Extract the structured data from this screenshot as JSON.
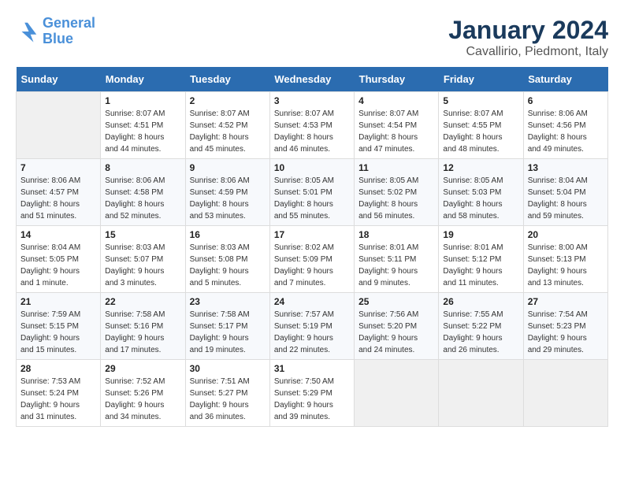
{
  "header": {
    "logo_line1": "General",
    "logo_line2": "Blue",
    "title": "January 2024",
    "subtitle": "Cavallirio, Piedmont, Italy"
  },
  "weekdays": [
    "Sunday",
    "Monday",
    "Tuesday",
    "Wednesday",
    "Thursday",
    "Friday",
    "Saturday"
  ],
  "weeks": [
    [
      {
        "day": "",
        "info": ""
      },
      {
        "day": "1",
        "info": "Sunrise: 8:07 AM\nSunset: 4:51 PM\nDaylight: 8 hours\nand 44 minutes."
      },
      {
        "day": "2",
        "info": "Sunrise: 8:07 AM\nSunset: 4:52 PM\nDaylight: 8 hours\nand 45 minutes."
      },
      {
        "day": "3",
        "info": "Sunrise: 8:07 AM\nSunset: 4:53 PM\nDaylight: 8 hours\nand 46 minutes."
      },
      {
        "day": "4",
        "info": "Sunrise: 8:07 AM\nSunset: 4:54 PM\nDaylight: 8 hours\nand 47 minutes."
      },
      {
        "day": "5",
        "info": "Sunrise: 8:07 AM\nSunset: 4:55 PM\nDaylight: 8 hours\nand 48 minutes."
      },
      {
        "day": "6",
        "info": "Sunrise: 8:06 AM\nSunset: 4:56 PM\nDaylight: 8 hours\nand 49 minutes."
      }
    ],
    [
      {
        "day": "7",
        "info": "Sunrise: 8:06 AM\nSunset: 4:57 PM\nDaylight: 8 hours\nand 51 minutes."
      },
      {
        "day": "8",
        "info": "Sunrise: 8:06 AM\nSunset: 4:58 PM\nDaylight: 8 hours\nand 52 minutes."
      },
      {
        "day": "9",
        "info": "Sunrise: 8:06 AM\nSunset: 4:59 PM\nDaylight: 8 hours\nand 53 minutes."
      },
      {
        "day": "10",
        "info": "Sunrise: 8:05 AM\nSunset: 5:01 PM\nDaylight: 8 hours\nand 55 minutes."
      },
      {
        "day": "11",
        "info": "Sunrise: 8:05 AM\nSunset: 5:02 PM\nDaylight: 8 hours\nand 56 minutes."
      },
      {
        "day": "12",
        "info": "Sunrise: 8:05 AM\nSunset: 5:03 PM\nDaylight: 8 hours\nand 58 minutes."
      },
      {
        "day": "13",
        "info": "Sunrise: 8:04 AM\nSunset: 5:04 PM\nDaylight: 8 hours\nand 59 minutes."
      }
    ],
    [
      {
        "day": "14",
        "info": "Sunrise: 8:04 AM\nSunset: 5:05 PM\nDaylight: 9 hours\nand 1 minute."
      },
      {
        "day": "15",
        "info": "Sunrise: 8:03 AM\nSunset: 5:07 PM\nDaylight: 9 hours\nand 3 minutes."
      },
      {
        "day": "16",
        "info": "Sunrise: 8:03 AM\nSunset: 5:08 PM\nDaylight: 9 hours\nand 5 minutes."
      },
      {
        "day": "17",
        "info": "Sunrise: 8:02 AM\nSunset: 5:09 PM\nDaylight: 9 hours\nand 7 minutes."
      },
      {
        "day": "18",
        "info": "Sunrise: 8:01 AM\nSunset: 5:11 PM\nDaylight: 9 hours\nand 9 minutes."
      },
      {
        "day": "19",
        "info": "Sunrise: 8:01 AM\nSunset: 5:12 PM\nDaylight: 9 hours\nand 11 minutes."
      },
      {
        "day": "20",
        "info": "Sunrise: 8:00 AM\nSunset: 5:13 PM\nDaylight: 9 hours\nand 13 minutes."
      }
    ],
    [
      {
        "day": "21",
        "info": "Sunrise: 7:59 AM\nSunset: 5:15 PM\nDaylight: 9 hours\nand 15 minutes."
      },
      {
        "day": "22",
        "info": "Sunrise: 7:58 AM\nSunset: 5:16 PM\nDaylight: 9 hours\nand 17 minutes."
      },
      {
        "day": "23",
        "info": "Sunrise: 7:58 AM\nSunset: 5:17 PM\nDaylight: 9 hours\nand 19 minutes."
      },
      {
        "day": "24",
        "info": "Sunrise: 7:57 AM\nSunset: 5:19 PM\nDaylight: 9 hours\nand 22 minutes."
      },
      {
        "day": "25",
        "info": "Sunrise: 7:56 AM\nSunset: 5:20 PM\nDaylight: 9 hours\nand 24 minutes."
      },
      {
        "day": "26",
        "info": "Sunrise: 7:55 AM\nSunset: 5:22 PM\nDaylight: 9 hours\nand 26 minutes."
      },
      {
        "day": "27",
        "info": "Sunrise: 7:54 AM\nSunset: 5:23 PM\nDaylight: 9 hours\nand 29 minutes."
      }
    ],
    [
      {
        "day": "28",
        "info": "Sunrise: 7:53 AM\nSunset: 5:24 PM\nDaylight: 9 hours\nand 31 minutes."
      },
      {
        "day": "29",
        "info": "Sunrise: 7:52 AM\nSunset: 5:26 PM\nDaylight: 9 hours\nand 34 minutes."
      },
      {
        "day": "30",
        "info": "Sunrise: 7:51 AM\nSunset: 5:27 PM\nDaylight: 9 hours\nand 36 minutes."
      },
      {
        "day": "31",
        "info": "Sunrise: 7:50 AM\nSunset: 5:29 PM\nDaylight: 9 hours\nand 39 minutes."
      },
      {
        "day": "",
        "info": ""
      },
      {
        "day": "",
        "info": ""
      },
      {
        "day": "",
        "info": ""
      }
    ]
  ]
}
